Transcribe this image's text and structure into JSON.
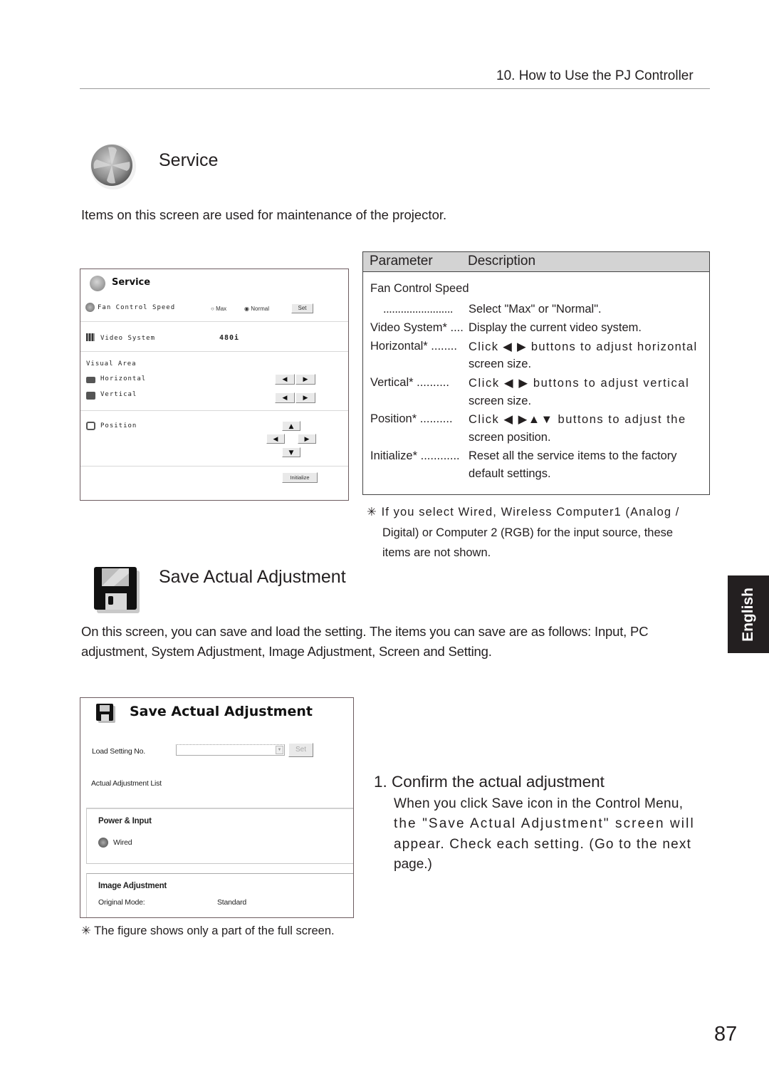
{
  "header": {
    "chapter": "10. How to Use the PJ Controller"
  },
  "service": {
    "title": "Service",
    "icon": "fan-icon",
    "intro": "Items on this screen are used for maintenance of the projector.",
    "screen": {
      "title": "Service",
      "fan_label": "Fan Control Speed",
      "fan_options": [
        "Max",
        "Normal"
      ],
      "fan_selected": "Normal",
      "set_label": "Set",
      "video_label": "Video System",
      "video_value": "480i",
      "visual_area_label": "Visual Area",
      "horizontal_label": "Horizontal",
      "vertical_label": "Vertical",
      "position_label": "Position",
      "initialize_label": "Initialize",
      "left_glyph": "◀",
      "right_glyph": "▶",
      "up_glyph": "▲",
      "down_glyph": "▼"
    },
    "table": {
      "headers": [
        "Parameter",
        "Description"
      ],
      "rows": [
        {
          "param": "Fan Control Speed",
          "desc": ""
        },
        {
          "param": "........................",
          "desc": "Select \"Max\" or \"Normal\"."
        },
        {
          "param": "Video System* ....",
          "desc": "Display the current video system."
        },
        {
          "param": "Horizontal* ........",
          "desc": "Click ◀ ▶ buttons to adjust horizontal",
          "cont": "screen size."
        },
        {
          "param": "Vertical* ..........",
          "desc": "Click ◀ ▶ buttons to adjust vertical",
          "cont": "screen size."
        },
        {
          "param": "Position* ..........",
          "desc": "Click ◀ ▶▲▼ buttons to adjust the",
          "cont": "screen position."
        },
        {
          "param": "Initialize* ............",
          "desc": "Reset all the service items to the factory",
          "cont": "default settings."
        }
      ]
    },
    "note": {
      "mark": "✳",
      "lines": [
        "If you select Wired, Wireless Computer1 (Analog /",
        "Digital) or Computer 2 (RGB) for the input source, these",
        "items are not shown."
      ]
    }
  },
  "save": {
    "title": "Save Actual Adjustment",
    "icon": "floppy-disk-icon",
    "intro": "On this screen, you can save and load the setting.  The items you can save are as follows: Input, PC adjustment, System Adjustment, Image Adjustment, Screen and Setting.",
    "screen": {
      "title": "Save Actual Adjustment",
      "load_label": "Load Setting No.",
      "load_value": "",
      "set_label": "Set",
      "list_label": "Actual Adjustment List",
      "group1_title": "Power & Input",
      "group1_item": "Wired",
      "group2_title": "Image Adjustment",
      "group2_key": "Original Mode:",
      "group2_value": "Standard"
    },
    "step": {
      "title": "1. Confirm the actual adjustment",
      "lines": [
        "When you click Save icon in the Control Menu,",
        "the \"Save Actual Adjustment\" screen will",
        "appear. Check each setting. (Go to the next",
        "page.)"
      ]
    },
    "figure_note": "✳ The figure shows only a part of the full screen."
  },
  "language_tab": "English",
  "page_number": "87"
}
